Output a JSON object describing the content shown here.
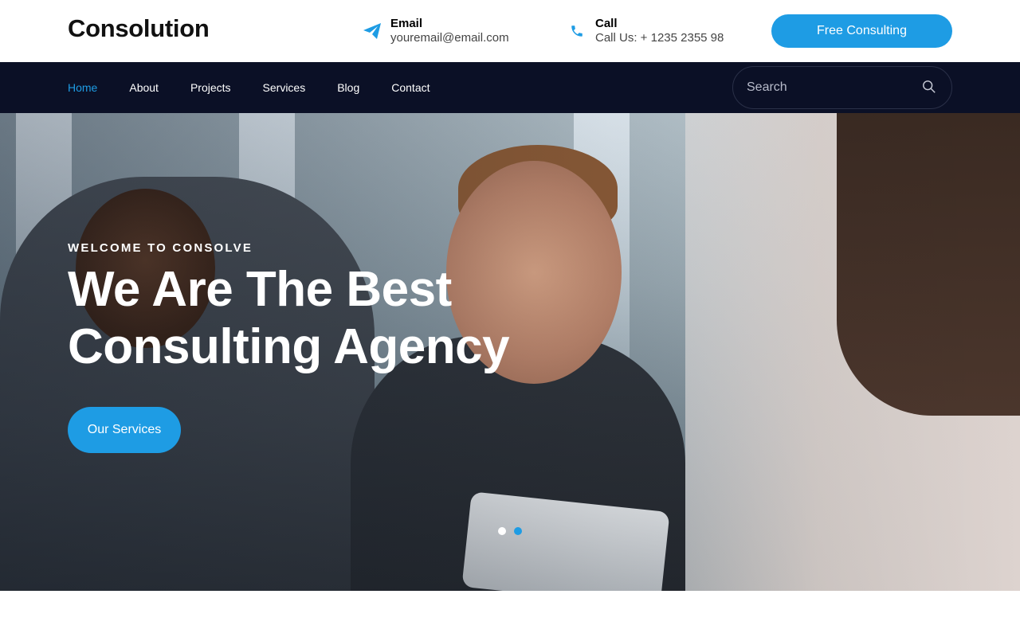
{
  "header": {
    "brand": "Consolution",
    "email": {
      "label": "Email",
      "value": "youremail@email.com",
      "icon": "paper-plane-icon"
    },
    "call": {
      "label": "Call",
      "value": "Call Us: + 1235 2355 98",
      "icon": "phone-icon"
    },
    "cta_label": "Free Consulting"
  },
  "nav": {
    "items": [
      {
        "label": "Home",
        "active": true
      },
      {
        "label": "About",
        "active": false
      },
      {
        "label": "Projects",
        "active": false
      },
      {
        "label": "Services",
        "active": false
      },
      {
        "label": "Blog",
        "active": false
      },
      {
        "label": "Contact",
        "active": false
      }
    ],
    "search_placeholder": "Search",
    "search_icon": "search-icon"
  },
  "hero": {
    "kicker": "WELCOME TO CONSOLVE",
    "headline_line1": "We Are The Best",
    "headline_line2": "Consulting Agency",
    "button_label": "Our Services",
    "slider": {
      "total": 2,
      "active_index": 1
    }
  },
  "colors": {
    "accent": "#1e9ce4",
    "nav_bg": "#0b1026",
    "brand_text": "#111111",
    "dot_inactive": "#ffffff"
  }
}
